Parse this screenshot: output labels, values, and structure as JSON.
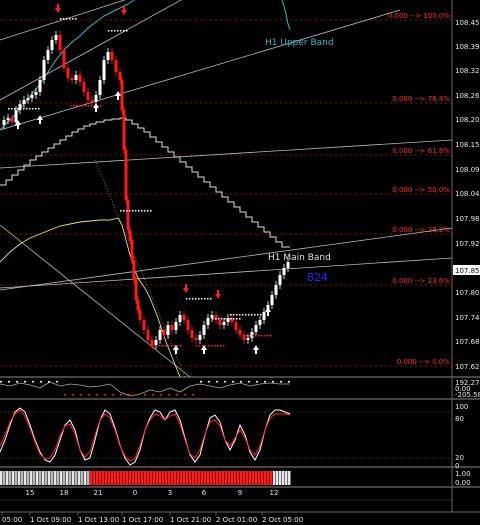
{
  "main": {
    "price_ticks": [
      "108.455",
      "108.390",
      "108.325",
      "108.265",
      "108.205",
      "108.155",
      "108.095",
      "108.045",
      "107.985",
      "107.925",
      "107.865",
      "107.805",
      "107.745",
      "107.685",
      "107.625"
    ],
    "current_price": "107.852",
    "fib_levels": [
      "0.000 --> 100.0%",
      "0.000 --> 76.4%",
      "0.000 --> 61.8%",
      "0.000 --> 50.0%",
      "0.000 --> 38.2%",
      "0.000 --> 23.6%",
      "0.000 --> 0.0%"
    ],
    "upper_band_label": "H1 Upper Band",
    "main_band_label": "H1 Main Band",
    "timer_label": "824",
    "colors": {
      "upper_band": "#39b6c7",
      "main_band_label": "#e0e0e0",
      "timer": "#2a2aff",
      "fib": "#ff2a2a",
      "down_candle": "#ff1a1a",
      "up_candle": "#ffffff"
    }
  },
  "indicator1": {
    "ticks": [
      "192.274",
      "0.00",
      "-205.58"
    ]
  },
  "indicator2": {
    "ticks": [
      "100",
      "80",
      "20",
      "0"
    ]
  },
  "indicator3": {
    "ticks": [
      "1.00",
      "0.00"
    ]
  },
  "time_axis": {
    "session_labels": [
      "15",
      "18",
      "21",
      "0",
      "3",
      "6",
      "9",
      "12"
    ],
    "date_labels": [
      "05:00",
      "1 Oct 09:00",
      "1 Oct 13:00",
      "1 Oct 17:00",
      "1 Oct 21:00",
      "2 Oct 01:00",
      "2 Oct 05:00"
    ]
  }
}
